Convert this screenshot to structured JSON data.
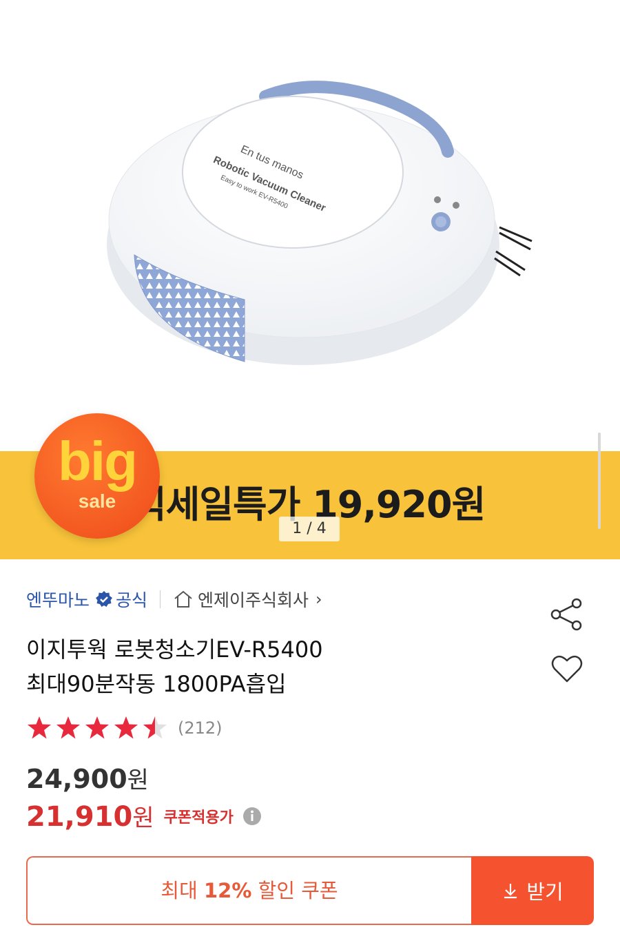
{
  "gallery": {
    "product_print": [
      "En tus manos",
      "Robotic Vacuum Cleaner",
      "Easy to work EV-R5400"
    ],
    "banner_text": "빅세일특가 19,920원",
    "badge_big": "big",
    "badge_sale": "sale",
    "pager": "1 / 4"
  },
  "seller": {
    "name": "엔뚜마노",
    "official_label": "공식",
    "shop_name": "엔제이주식회사",
    "chevron": "›"
  },
  "product": {
    "title_line1": "이지투웍 로봇청소기EV-R5400",
    "title_line2": "최대90분작동 1800PA흡입"
  },
  "rating": {
    "value": 4.5,
    "max": 5,
    "review_count": "(212)"
  },
  "price": {
    "original": "24,900",
    "sale": "21,910",
    "unit": "원",
    "coupon_label": "쿠폰적용가"
  },
  "coupon": {
    "prefix": "최대 ",
    "percent": "12%",
    "suffix": " 할인 쿠폰",
    "receive_label": "받기"
  },
  "colors": {
    "accent_orange": "#f5532f",
    "sale_red": "#d63030",
    "seller_blue": "#2a55a8",
    "banner_yellow": "#f8c33a"
  }
}
